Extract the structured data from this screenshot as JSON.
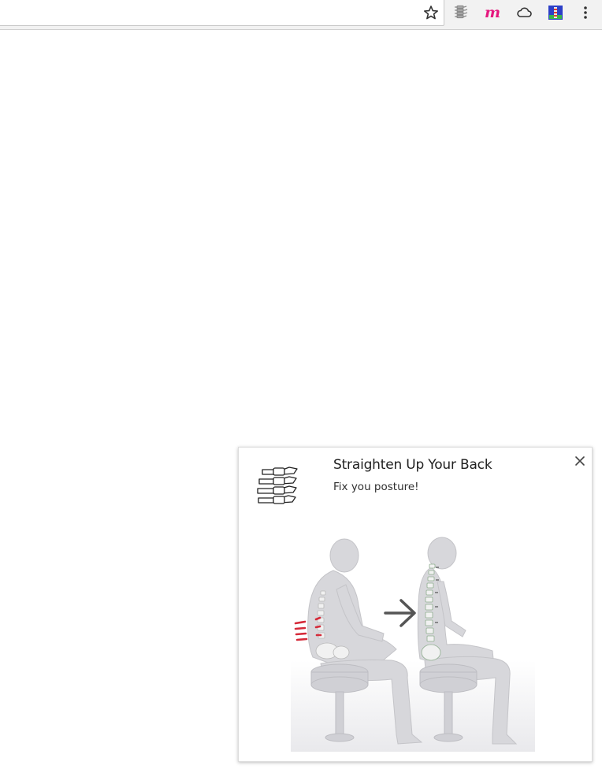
{
  "toolbar": {
    "bookmark_icon": "star-icon",
    "extensions": [
      {
        "name": "spine-extension-icon"
      },
      {
        "name": "m-extension-icon",
        "glyph": "m",
        "color": "#e5177e"
      },
      {
        "name": "cloud-extension-icon"
      },
      {
        "name": "colorful-extension-icon"
      }
    ],
    "menu_icon": "more-vert-icon"
  },
  "notification": {
    "title": "Straighten Up Your Back",
    "message": "Fix you posture!",
    "icon": "spine-icon",
    "image": "posture-illustration",
    "accent_color": "#d52b3a"
  }
}
